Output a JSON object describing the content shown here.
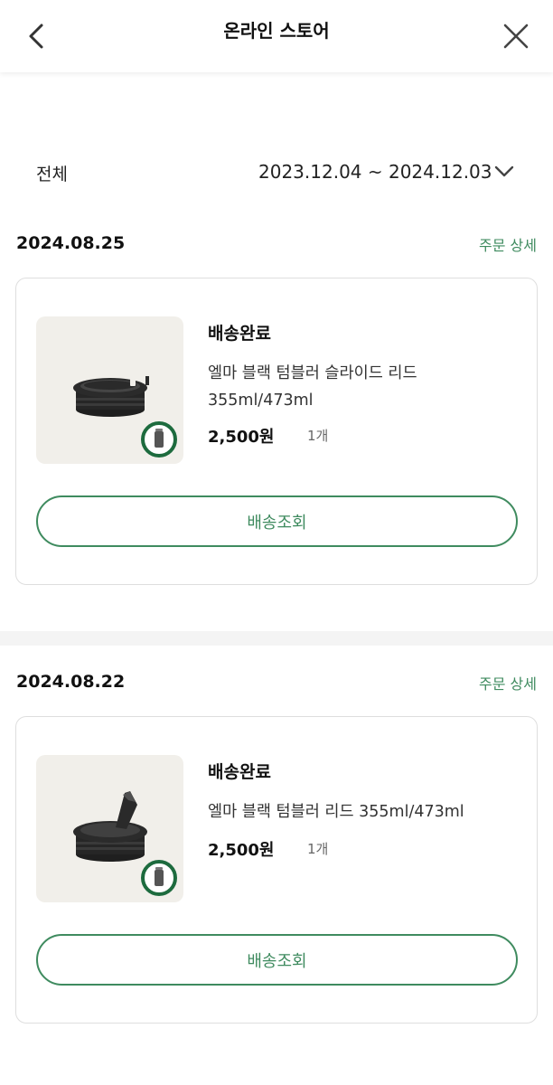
{
  "header": {
    "title": "온라인 스토어",
    "back_icon": "chevron-left-icon",
    "close_icon": "close-icon"
  },
  "filter": {
    "scope": "전체",
    "date_range": "2023.12.04 ~ 2024.12.03",
    "dropdown_icon": "chevron-down-icon"
  },
  "colors": {
    "accent": "#3f8b5f",
    "card_border": "#dedede",
    "thumb_bg": "#f1efea",
    "divider": "#f4f4f4"
  },
  "orders": [
    {
      "date": "2024.08.25",
      "detail_label": "주문 상세",
      "item": {
        "status": "배송완료",
        "name": "엘마 블랙 텀블러 슬라이드 리드 355ml/473ml",
        "price": "2,500원",
        "qty": "1개",
        "image_icon": "tumbler-slide-lid-image"
      },
      "track_label": "배송조회"
    },
    {
      "date": "2024.08.22",
      "detail_label": "주문 상세",
      "item": {
        "status": "배송완료",
        "name": "엘마 블랙 텀블러 리드 355ml/473ml",
        "price": "2,500원",
        "qty": "1개",
        "image_icon": "tumbler-lid-image"
      },
      "track_label": "배송조회"
    }
  ]
}
